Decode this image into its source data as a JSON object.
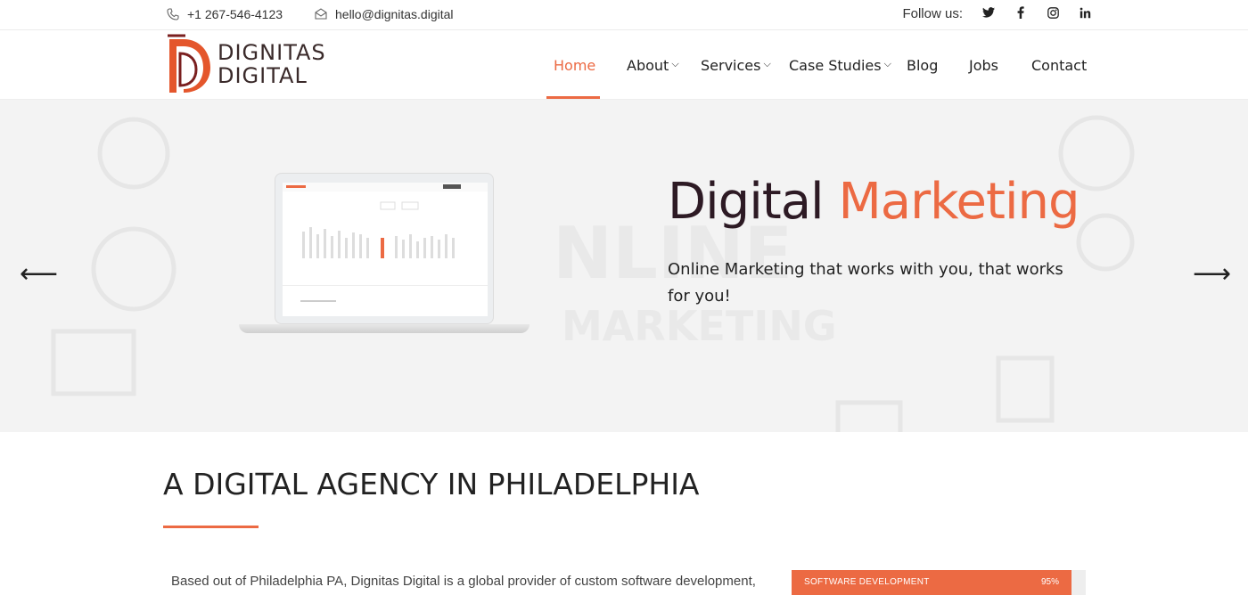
{
  "topbar": {
    "phone": "+1 267-546-4123",
    "email": "hello@dignitas.digital",
    "follow_label": "Follow us:",
    "social": [
      {
        "icon": "twitter-icon",
        "glyph": "𝕥"
      },
      {
        "icon": "facebook-icon",
        "glyph": "f"
      },
      {
        "icon": "instagram-icon",
        "glyph": "◎"
      },
      {
        "icon": "linkedin-icon",
        "glyph": "in"
      }
    ]
  },
  "logo": {
    "line1": "DIGNITAS",
    "line2": "DIGITAL"
  },
  "nav": {
    "home": "Home",
    "about": "About",
    "services": "Services",
    "case_studies": "Case Studies",
    "blog": "Blog",
    "jobs": "Jobs",
    "contact": "Contact"
  },
  "hero": {
    "title_main": "Digital",
    "title_accent": "Marketing",
    "subtitle": "Online Marketing that works with you, that works for you!",
    "prev_arrow": "⟵",
    "next_arrow": "⟶"
  },
  "section": {
    "title": "A DIGITAL AGENCY IN PHILADELPHIA",
    "paragraph": "Based out of Philadelphia PA, Dignitas Digital is a global provider of custom software development,"
  },
  "skills": [
    {
      "label": "SOFTWARE DEVELOPMENT",
      "percent_text": "95%",
      "value": 95
    }
  ],
  "colors": {
    "accent": "#ec6a43",
    "dark": "#2d1a24"
  }
}
